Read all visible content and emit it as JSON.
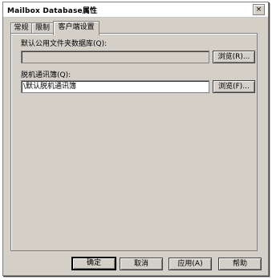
{
  "window": {
    "title": "Mailbox Database属性",
    "close_glyph": "×"
  },
  "tabs": [
    {
      "label": "常规"
    },
    {
      "label": "限制"
    },
    {
      "label": "客户端设置",
      "active": true
    }
  ],
  "public_folder": {
    "label": "默认公用文件夹数据库(Q):",
    "value": "",
    "browse_label": "浏览(R)..."
  },
  "oab": {
    "label": "脱机通讯簿(Q):",
    "value": "\\默认脱机通讯簿",
    "browse_label": "浏览(F)..."
  },
  "footer": {
    "ok": "确定",
    "cancel": "取消",
    "apply": "应用(A)",
    "help": "帮助"
  }
}
